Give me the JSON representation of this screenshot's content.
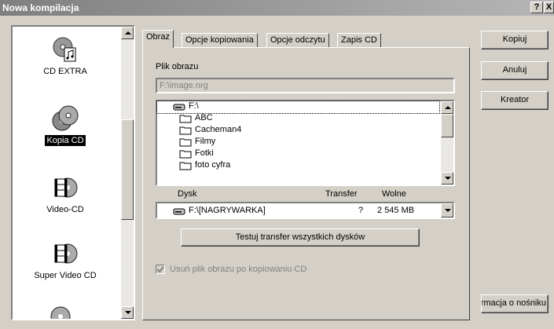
{
  "window": {
    "title": "Nowa kompilacja",
    "help_label": "?",
    "close_label": "X"
  },
  "sidebar": {
    "items": [
      {
        "label": "CD EXTRA",
        "icon": "cd-extra-icon",
        "selected": false
      },
      {
        "label": "Kopia CD",
        "icon": "cd-copy-icon",
        "selected": true
      },
      {
        "label": "Video-CD",
        "icon": "video-cd-icon",
        "selected": false
      },
      {
        "label": "Super Video CD",
        "icon": "super-video-cd-icon",
        "selected": false
      }
    ]
  },
  "tabs": [
    {
      "label": "Obraz",
      "active": true
    },
    {
      "label": "Opcje kopiowania",
      "active": false
    },
    {
      "label": "Opcje odczytu",
      "active": false
    },
    {
      "label": "Zapis CD",
      "active": false
    }
  ],
  "image_file": {
    "label": "Plik obrazu",
    "value": "F:\\image.nrg"
  },
  "folder_tree": {
    "root": "F:\\",
    "folders": [
      "ABC",
      "Cacheman4",
      "Filmy",
      "Fotki",
      "foto cyfra"
    ]
  },
  "drive_table": {
    "headers": {
      "disk": "Dysk",
      "transfer": "Transfer",
      "free": "Wolne"
    },
    "selected": {
      "disk": "F:\\[NAGRYWARKA]",
      "transfer": "?",
      "free": "2 545 MB"
    }
  },
  "test_button_label": "Testuj transfer wszystkich dysków",
  "delete_checkbox": {
    "label": "Usuń plik obrazu po kopiowaniu CD",
    "checked": true
  },
  "buttons": {
    "copy": "Kopiuj",
    "cancel": "Anuluj",
    "wizard": "Kreator",
    "media_info": "Informacja o nośniku"
  },
  "colors": {
    "selection": "#000000",
    "face": "#d4d0c8",
    "titlebar": "#808080"
  }
}
